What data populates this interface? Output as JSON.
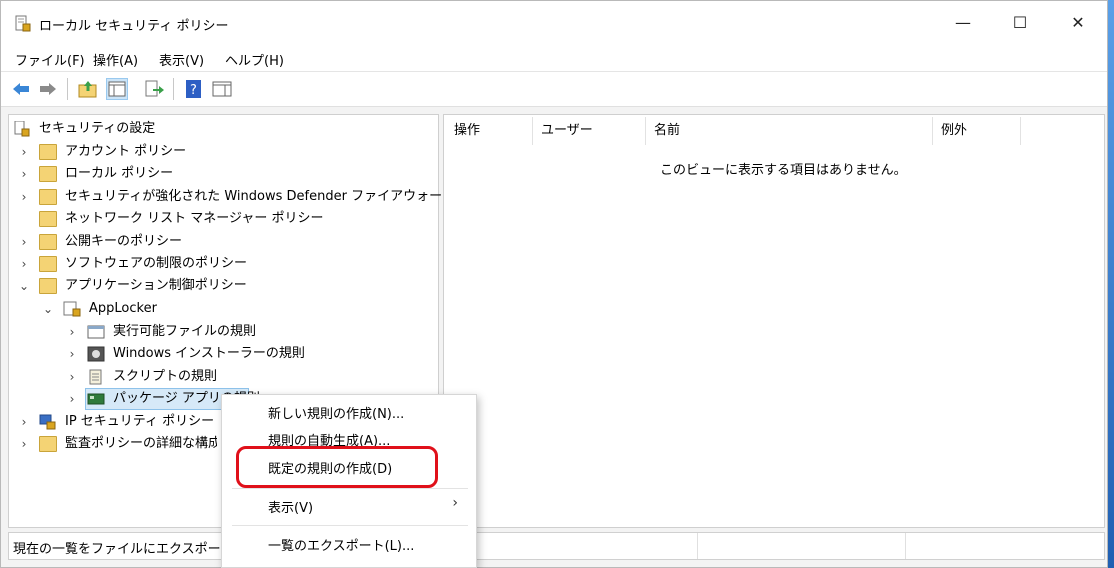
{
  "window": {
    "title": "ローカル セキュリティ ポリシー",
    "minimize": "—",
    "maximize": "☐",
    "close": "✕"
  },
  "menu": [
    "ファイル(F)",
    "操作(A)",
    "表示(V)",
    "ヘルプ(H)"
  ],
  "toolbar": [
    "back-arrow-icon",
    "forward-arrow-icon",
    "up-folder-icon",
    "show-tree-icon",
    "export-list-icon",
    "help-icon",
    "action-pane-icon"
  ],
  "tree": {
    "root": "セキュリティの設定",
    "items": [
      "アカウント ポリシー",
      "ローカル ポリシー",
      "セキュリティが強化された Windows Defender ファイアウォール",
      "ネットワーク リスト マネージャー ポリシー",
      "公開キーのポリシー",
      "ソフトウェアの制限のポリシー",
      "アプリケーション制御ポリシー",
      "AppLocker",
      "実行可能ファイルの規則",
      "Windows インストーラーの規則",
      "スクリプトの規則",
      "パッケージ アプリの規則",
      "IP セキュリティ ポリシー (ローカル コンピューター)",
      "監査ポリシーの詳細な構成"
    ]
  },
  "list": {
    "columns": [
      "操作",
      "ユーザー",
      "名前",
      "例外"
    ],
    "empty_message": "このビューに表示する項目はありません。"
  },
  "context_menu": {
    "items": [
      "新しい規則の作成(N)...",
      "規則の自動生成(A)...",
      "既定の規則の作成(D)",
      "表示(V)",
      "一覧のエクスポート(L)..."
    ],
    "submenu_arrow": "›"
  },
  "status": {
    "text": "現在の一覧をファイルにエクスポートします。"
  },
  "colors": {
    "highlight": "#e0101a",
    "selection": "#d6e9f8"
  }
}
